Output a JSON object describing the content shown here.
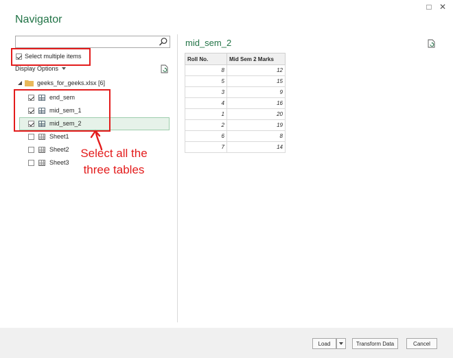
{
  "window": {
    "title": "Navigator",
    "maximize_icon": "□",
    "close_icon": "✕"
  },
  "search": {
    "placeholder": ""
  },
  "select_multiple": {
    "label": "Select multiple items",
    "checked": true
  },
  "display_options": {
    "label": "Display Options"
  },
  "tree": {
    "file": {
      "label": "geeks_for_geeks.xlsx [6]"
    },
    "items": [
      {
        "label": "end_sem",
        "checked": true,
        "kind": "table"
      },
      {
        "label": "mid_sem_1",
        "checked": true,
        "kind": "table"
      },
      {
        "label": "mid_sem_2",
        "checked": true,
        "kind": "table",
        "selected": true
      },
      {
        "label": "Sheet1",
        "checked": false,
        "kind": "sheet"
      },
      {
        "label": "Sheet2",
        "checked": false,
        "kind": "sheet"
      },
      {
        "label": "Sheet3",
        "checked": false,
        "kind": "sheet"
      }
    ]
  },
  "annotation": {
    "line1": "Select all the",
    "line2": "three tables",
    "color": "#e31b1b"
  },
  "preview": {
    "title": "mid_sem_2",
    "columns": [
      "Roll No.",
      "Mid Sem 2 Marks"
    ],
    "rows": [
      [
        "8",
        "12"
      ],
      [
        "5",
        "15"
      ],
      [
        "3",
        "9"
      ],
      [
        "4",
        "16"
      ],
      [
        "1",
        "20"
      ],
      [
        "2",
        "19"
      ],
      [
        "6",
        "8"
      ],
      [
        "7",
        "14"
      ]
    ]
  },
  "footer": {
    "load": "Load",
    "transform": "Transform Data",
    "cancel": "Cancel"
  },
  "colors": {
    "accent": "#217346",
    "highlight": "#e31b1b"
  }
}
